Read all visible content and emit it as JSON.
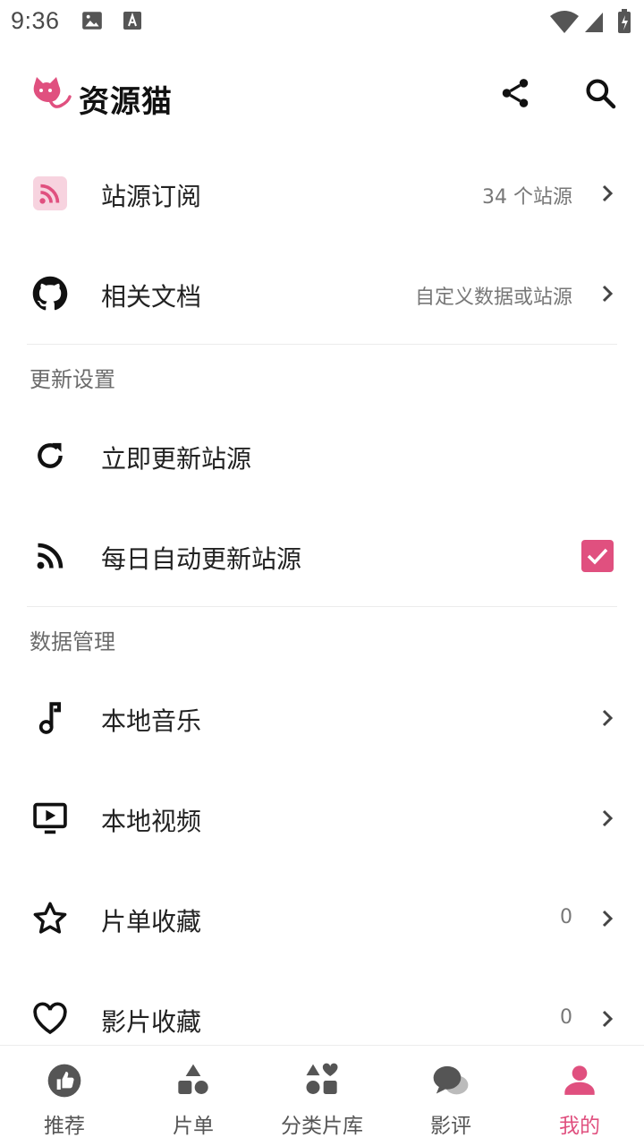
{
  "status_bar": {
    "time": "9:36"
  },
  "app": {
    "title": "资源猫",
    "accent": "#e0507f"
  },
  "rows": {
    "subscriptions": {
      "label": "站源订阅",
      "value": "34 个站源"
    },
    "docs": {
      "label": "相关文档",
      "value": "自定义数据或站源"
    },
    "update_now": {
      "label": "立即更新站源"
    },
    "daily_update": {
      "label": "每日自动更新站源",
      "checked": true
    },
    "local_music": {
      "label": "本地音乐"
    },
    "local_video": {
      "label": "本地视频"
    },
    "list_favorites": {
      "label": "片单收藏",
      "value": "0"
    },
    "movie_favorites": {
      "label": "影片收藏",
      "value": "0"
    }
  },
  "sections": {
    "update": "更新设置",
    "data": "数据管理"
  },
  "bottom_nav": {
    "items": [
      {
        "label": "推荐",
        "icon": "thumb-up-icon"
      },
      {
        "label": "片单",
        "icon": "shapes-icon"
      },
      {
        "label": "分类片库",
        "icon": "category-icon"
      },
      {
        "label": "影评",
        "icon": "chat-icon"
      },
      {
        "label": "我的",
        "icon": "person-icon",
        "active": true
      }
    ]
  }
}
